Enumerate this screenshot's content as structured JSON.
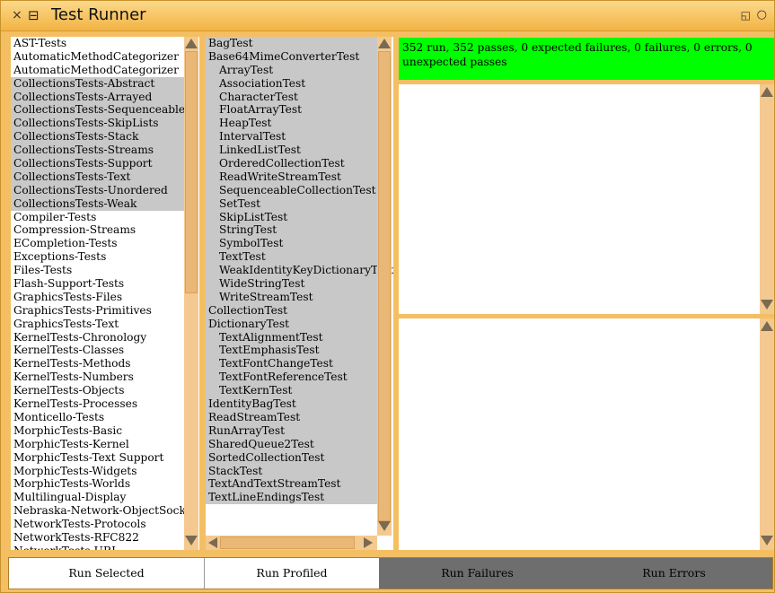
{
  "window": {
    "title": "Test Runner",
    "close_glyph": "×",
    "menu_glyph": "⊟",
    "collapse_glyph": "◱",
    "expand_glyph": "○"
  },
  "packages": {
    "items": [
      {
        "label": "AST-Tests",
        "selected": false
      },
      {
        "label": "AutomaticMethodCategorizer",
        "selected": false
      },
      {
        "label": "AutomaticMethodCategorizer",
        "selected": false
      },
      {
        "label": "CollectionsTests-Abstract",
        "selected": true
      },
      {
        "label": "CollectionsTests-Arrayed",
        "selected": true
      },
      {
        "label": "CollectionsTests-Sequenceable",
        "selected": true
      },
      {
        "label": "CollectionsTests-SkipLists",
        "selected": true
      },
      {
        "label": "CollectionsTests-Stack",
        "selected": true
      },
      {
        "label": "CollectionsTests-Streams",
        "selected": true
      },
      {
        "label": "CollectionsTests-Support",
        "selected": true
      },
      {
        "label": "CollectionsTests-Text",
        "selected": true
      },
      {
        "label": "CollectionsTests-Unordered",
        "selected": true
      },
      {
        "label": "CollectionsTests-Weak",
        "selected": true
      },
      {
        "label": "Compiler-Tests",
        "selected": false
      },
      {
        "label": "Compression-Streams",
        "selected": false
      },
      {
        "label": "ECompletion-Tests",
        "selected": false
      },
      {
        "label": "Exceptions-Tests",
        "selected": false
      },
      {
        "label": "Files-Tests",
        "selected": false
      },
      {
        "label": "Flash-Support-Tests",
        "selected": false
      },
      {
        "label": "GraphicsTests-Files",
        "selected": false
      },
      {
        "label": "GraphicsTests-Primitives",
        "selected": false
      },
      {
        "label": "GraphicsTests-Text",
        "selected": false
      },
      {
        "label": "KernelTests-Chronology",
        "selected": false
      },
      {
        "label": "KernelTests-Classes",
        "selected": false
      },
      {
        "label": "KernelTests-Methods",
        "selected": false
      },
      {
        "label": "KernelTests-Numbers",
        "selected": false
      },
      {
        "label": "KernelTests-Objects",
        "selected": false
      },
      {
        "label": "KernelTests-Processes",
        "selected": false
      },
      {
        "label": "Monticello-Tests",
        "selected": false
      },
      {
        "label": "MorphicTests-Basic",
        "selected": false
      },
      {
        "label": "MorphicTests-Kernel",
        "selected": false
      },
      {
        "label": "MorphicTests-Text Support",
        "selected": false
      },
      {
        "label": "MorphicTests-Widgets",
        "selected": false
      },
      {
        "label": "MorphicTests-Worlds",
        "selected": false
      },
      {
        "label": "Multilingual-Display",
        "selected": false
      },
      {
        "label": "Nebraska-Network-ObjectSocket",
        "selected": false
      },
      {
        "label": "NetworkTests-Protocols",
        "selected": false
      },
      {
        "label": "NetworkTests-RFC822",
        "selected": false
      },
      {
        "label": "NetworkTests-URI",
        "selected": false
      }
    ]
  },
  "classes": {
    "items": [
      {
        "label": "BagTest",
        "indent": false
      },
      {
        "label": "Base64MimeConverterTest",
        "indent": false
      },
      {
        "label": "ArrayTest",
        "indent": true
      },
      {
        "label": "AssociationTest",
        "indent": true
      },
      {
        "label": "CharacterTest",
        "indent": true
      },
      {
        "label": "FloatArrayTest",
        "indent": true
      },
      {
        "label": "HeapTest",
        "indent": true
      },
      {
        "label": "IntervalTest",
        "indent": true
      },
      {
        "label": "LinkedListTest",
        "indent": true
      },
      {
        "label": "OrderedCollectionTest",
        "indent": true
      },
      {
        "label": "ReadWriteStreamTest",
        "indent": true
      },
      {
        "label": "SequenceableCollectionTest",
        "indent": true
      },
      {
        "label": "SetTest",
        "indent": true
      },
      {
        "label": "SkipListTest",
        "indent": true
      },
      {
        "label": "StringTest",
        "indent": true
      },
      {
        "label": "SymbolTest",
        "indent": true
      },
      {
        "label": "TextTest",
        "indent": true
      },
      {
        "label": "WeakIdentityKeyDictionaryTest",
        "indent": true
      },
      {
        "label": "WideStringTest",
        "indent": true
      },
      {
        "label": "WriteStreamTest",
        "indent": true
      },
      {
        "label": "CollectionTest",
        "indent": false
      },
      {
        "label": "DictionaryTest",
        "indent": false
      },
      {
        "label": "TextAlignmentTest",
        "indent": true
      },
      {
        "label": "TextEmphasisTest",
        "indent": true
      },
      {
        "label": "TextFontChangeTest",
        "indent": true
      },
      {
        "label": "TextFontReferenceTest",
        "indent": true
      },
      {
        "label": "TextKernTest",
        "indent": true
      },
      {
        "label": "IdentityBagTest",
        "indent": false
      },
      {
        "label": "ReadStreamTest",
        "indent": false
      },
      {
        "label": "RunArrayTest",
        "indent": false
      },
      {
        "label": "SharedQueue2Test",
        "indent": false
      },
      {
        "label": "SortedCollectionTest",
        "indent": false
      },
      {
        "label": "StackTest",
        "indent": false
      },
      {
        "label": "TextAndTextStreamTest",
        "indent": false
      },
      {
        "label": "TextLineEndingsTest",
        "indent": false
      }
    ]
  },
  "status": {
    "text": "352 run, 352 passes, 0 expected failures, 0 failures, 0 errors, 0 unexpected passes",
    "color": "#00ff00"
  },
  "buttons": {
    "run_selected": "Run Selected",
    "run_profiled": "Run Profiled",
    "run_failures": "Run Failures",
    "run_errors": "Run Errors"
  },
  "colors": {
    "frame": "#f4bf62",
    "selection": "#c8c8c8",
    "disabled_button": "#6e6e6e"
  }
}
